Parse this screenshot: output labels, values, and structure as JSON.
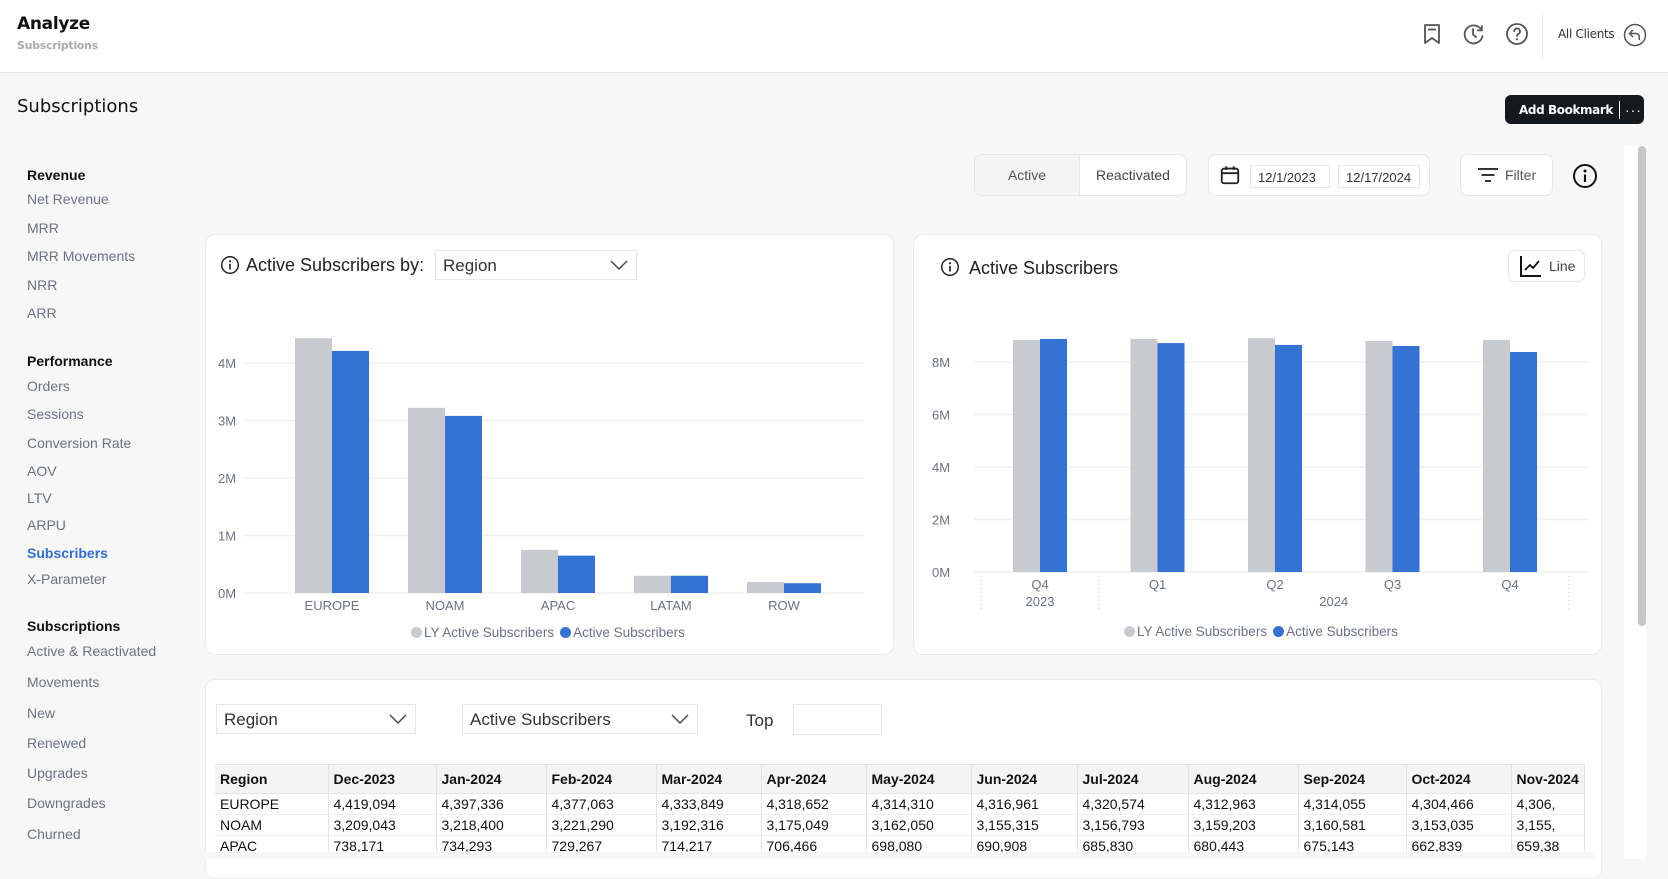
{
  "header": {
    "app_title": "Analyze",
    "app_subtitle": "Subscriptions",
    "all_clients_label": "All Clients",
    "icons": [
      "bookmark-icon",
      "history-icon",
      "help-icon",
      "back-arrow-icon"
    ]
  },
  "page": {
    "title": "Subscriptions",
    "add_bookmark_label": "Add Bookmark",
    "more_label": "···"
  },
  "sidebar": {
    "sections": [
      {
        "heading": "Revenue",
        "items": [
          "Net Revenue",
          "MRR",
          "MRR Movements",
          "NRR",
          "ARR"
        ]
      },
      {
        "heading": "Performance",
        "items": [
          "Orders",
          "Sessions",
          "Conversion Rate",
          "AOV",
          "LTV",
          "ARPU",
          "Subscribers",
          "X-Parameter"
        ]
      },
      {
        "heading": "Subscriptions",
        "items": [
          "Active & Reactivated",
          "Movements",
          "New",
          "Renewed",
          "Upgrades",
          "Downgrades",
          "Churned"
        ]
      }
    ],
    "active_item": "Subscribers"
  },
  "controls": {
    "segment": {
      "options": [
        "Active",
        "Reactivated"
      ],
      "selected": "Active"
    },
    "date_start": "12/1/2023",
    "date_end": "12/17/2024",
    "filter_label": "Filter"
  },
  "colors": {
    "ly": "#c7cacf",
    "active": "#3472d4",
    "accent": "#2f6fd6",
    "dark_button": "#15181d"
  },
  "chart_left": {
    "title": "Active Subscribers by:",
    "dimension_selected": "Region",
    "legend": [
      "LY Active Subscribers",
      "Active Subscribers"
    ]
  },
  "chart_right": {
    "title": "Active Subscribers",
    "chart_type_button": "Line",
    "legend": [
      "LY Active Subscribers",
      "Active Subscribers"
    ]
  },
  "chart_data": [
    {
      "type": "bar",
      "title": "Active Subscribers by: Region",
      "categories": [
        "EUROPE",
        "NOAM",
        "APAC",
        "LATAM",
        "ROW"
      ],
      "series": [
        {
          "name": "LY Active Subscribers",
          "values": [
            4.43,
            3.22,
            0.75,
            0.3,
            0.19
          ]
        },
        {
          "name": "Active Subscribers",
          "values": [
            4.21,
            3.08,
            0.65,
            0.3,
            0.17
          ]
        }
      ],
      "unit": "M",
      "yticks": [
        0,
        1,
        2,
        3,
        4
      ],
      "ytick_labels": [
        "0M",
        "1M",
        "2M",
        "3M",
        "4M"
      ],
      "ylim": [
        0,
        4.6
      ],
      "grid": true,
      "legend_position": "bottom"
    },
    {
      "type": "bar",
      "title": "Active Subscribers",
      "categories": [
        "Q4",
        "Q1",
        "Q2",
        "Q3",
        "Q4"
      ],
      "category_groups": [
        {
          "label": "2023",
          "span": 1
        },
        {
          "label": "2024",
          "span": 4
        }
      ],
      "series": [
        {
          "name": "LY Active Subscribers",
          "values": [
            8.84,
            8.88,
            8.91,
            8.8,
            8.84
          ]
        },
        {
          "name": "Active Subscribers",
          "values": [
            8.88,
            8.72,
            8.65,
            8.61,
            8.38
          ]
        }
      ],
      "unit": "M",
      "yticks": [
        0,
        2,
        4,
        6,
        8
      ],
      "ytick_labels": [
        "0M",
        "2M",
        "4M",
        "6M",
        "8M"
      ],
      "ylim": [
        0,
        9.6
      ],
      "grid": true,
      "legend_position": "bottom"
    }
  ],
  "table_section": {
    "dimension_selected": "Region",
    "metric_selected": "Active Subscribers",
    "top_label": "Top",
    "top_value": "",
    "columns": [
      "Region",
      "Dec-2023",
      "Jan-2024",
      "Feb-2024",
      "Mar-2024",
      "Apr-2024",
      "May-2024",
      "Jun-2024",
      "Jul-2024",
      "Aug-2024",
      "Sep-2024",
      "Oct-2024",
      "Nov-2024"
    ],
    "rows": [
      [
        "EUROPE",
        "4,419,094",
        "4,397,336",
        "4,377,063",
        "4,333,849",
        "4,318,652",
        "4,314,310",
        "4,316,961",
        "4,320,574",
        "4,312,963",
        "4,314,055",
        "4,304,466",
        "4,306,"
      ],
      [
        "NOAM",
        "3,209,043",
        "3,218,400",
        "3,221,290",
        "3,192,316",
        "3,175,049",
        "3,162,050",
        "3,155,315",
        "3,156,793",
        "3,159,203",
        "3,160,581",
        "3,153,035",
        "3,155,"
      ],
      [
        "APAC",
        "738,171",
        "734,293",
        "729,267",
        "714,217",
        "706,466",
        "698,080",
        "690,908",
        "685,830",
        "680,443",
        "675,143",
        "662,839",
        "659,38"
      ]
    ]
  }
}
